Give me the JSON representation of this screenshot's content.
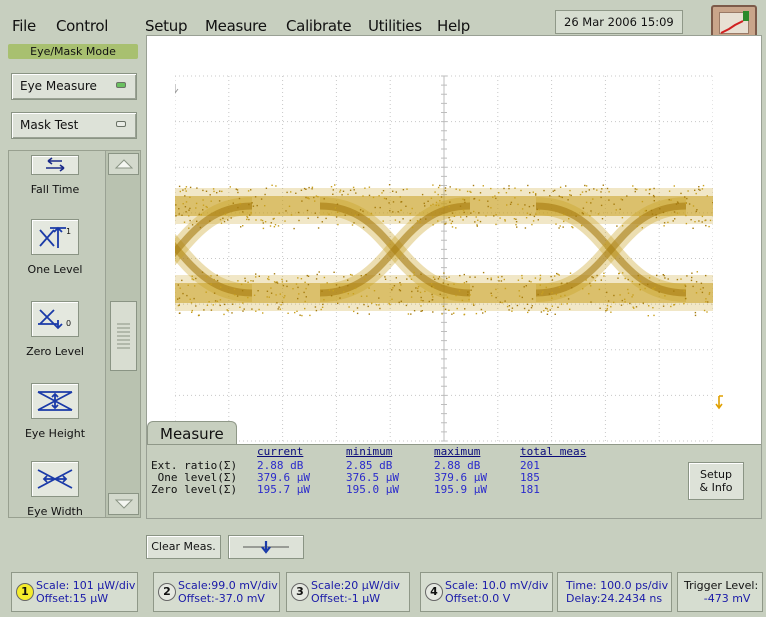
{
  "menu": {
    "file": "File",
    "control": "Control",
    "setup": "Setup",
    "measure": "Measure",
    "calibrate": "Calibrate",
    "utilities": "Utilities",
    "help": "Help"
  },
  "datetime": "26 Mar 2006  15:09",
  "mode_label": "Eye/Mask Mode",
  "side_buttons": {
    "eye_measure": "Eye Measure",
    "mask_test": "Mask Test"
  },
  "palette": {
    "fall_time": "Fall Time",
    "one_level": "One Level",
    "zero_level": "Zero Level",
    "eye_height": "Eye Height",
    "eye_width": "Eye Width"
  },
  "measure": {
    "tab": "Measure",
    "headers": {
      "current": "current",
      "minimum": "minimum",
      "maximum": "maximum",
      "total": "total meas"
    },
    "rows": [
      {
        "label": "Ext. ratio(Σ)",
        "current": "2.88 dB",
        "minimum": "2.85 dB",
        "maximum": "2.88 dB",
        "total": "201"
      },
      {
        "label": " One level(Σ)",
        "current": "379.6 µW",
        "minimum": "376.5 µW",
        "maximum": "379.6 µW",
        "total": "185"
      },
      {
        "label": "Zero level(Σ)",
        "current": "195.7 µW",
        "minimum": "195.0 µW",
        "maximum": "195.9 µW",
        "total": "181"
      }
    ],
    "setup_line1": "Setup",
    "setup_line2": "& Info"
  },
  "clear_meas": "Clear Meas.",
  "status": [
    {
      "num": "1",
      "line1": "Scale: 101 µW/div",
      "line2": "Offset:15 µW"
    },
    {
      "num": "2",
      "line1": "Scale:99.0 mV/div",
      "line2": "Offset:-37.0 mV"
    },
    {
      "num": "3",
      "line1": "Scale:20 µW/div",
      "line2": "Offset:-1 µW"
    },
    {
      "num": "4",
      "line1": "Scale: 10.0 mV/div",
      "line2": "Offset:0.0 V"
    }
  ],
  "timebase": {
    "line1": "Time: 100.0 ps/div",
    "line2": "Delay:24.2434 ns"
  },
  "trigger": {
    "line1": "Trigger Level:",
    "line2": "-473 mV"
  },
  "colors": {
    "trace": "#c8a020",
    "trace_dark": "#a67c10",
    "accent_green": "#a8c070",
    "value_blue": "#2a2acc"
  }
}
